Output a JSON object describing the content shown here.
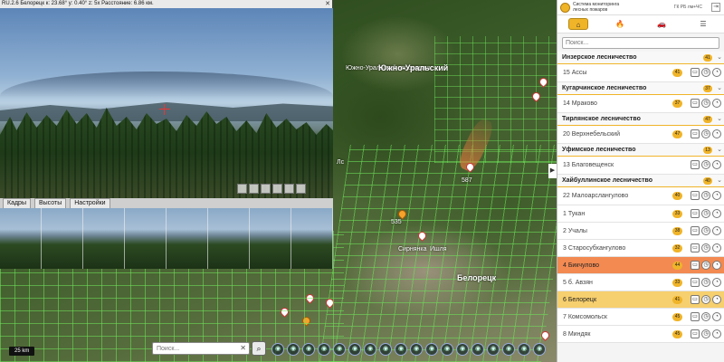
{
  "camera": {
    "title": "RU.2.6 Белорецк к: 23.68° у: 0.40° z: 5x Расстояние: 6.86 км.",
    "tabs": [
      "Кадры",
      "Высоты",
      "Настройки"
    ]
  },
  "map": {
    "labels": {
      "zone1": "Южно-Уральский заповедник",
      "zone2": "Южно-Уральский",
      "area": "Ишля",
      "city": "Белорецк",
      "town": "Сирнянка",
      "road": "Лс"
    },
    "pin_labels": [
      "535",
      "587"
    ],
    "scale": "25 km",
    "search_placeholder": "Поиск...",
    "tools": [
      "◉",
      "◉",
      "◉",
      "◉",
      "◉",
      "◉",
      "◉",
      "◉",
      "◉",
      "◉",
      "◉",
      "◉",
      "◉",
      "◉",
      "◉",
      "◉",
      "◉",
      "◉"
    ]
  },
  "panel": {
    "system_title": "Система мониторинга лесных пожаров",
    "user": "ГК РБ лм+ЧС",
    "nav": [
      "⌂",
      "🔥",
      "🚗",
      "☰"
    ],
    "search_placeholder": "Поиск...",
    "groups": [
      {
        "name": "Инзерское лесничество",
        "count": "41",
        "stations": [
          {
            "name": "15 Ассы",
            "badge": "41",
            "state": ""
          }
        ]
      },
      {
        "name": "Кугарчинское лесничество",
        "count": "37",
        "stations": [
          {
            "name": "14 Мраково",
            "badge": "37",
            "state": ""
          }
        ]
      },
      {
        "name": "Тирлянское лесничество",
        "count": "47",
        "stations": [
          {
            "name": "20 Верхнебельский",
            "badge": "47",
            "state": ""
          }
        ]
      },
      {
        "name": "Уфимское лесничество",
        "count": "13",
        "stations": [
          {
            "name": "13 Благовещенск",
            "badge": "",
            "state": ""
          }
        ]
      },
      {
        "name": "Хайбуллинское лесничество",
        "count": "40",
        "stations": [
          {
            "name": "22 Малоарслангулово",
            "badge": "40",
            "state": ""
          },
          {
            "name": "1 Тукан",
            "badge": "33",
            "state": ""
          },
          {
            "name": "2 Учалы",
            "badge": "38",
            "state": ""
          },
          {
            "name": "3 Старосубхангулово",
            "badge": "32",
            "state": ""
          },
          {
            "name": "4 Бикчулово",
            "badge": "44",
            "state": "hl-orange"
          },
          {
            "name": "5 б. Авзян",
            "badge": "33",
            "state": ""
          },
          {
            "name": "6 Белорецк",
            "badge": "41",
            "state": "hl-yellow"
          },
          {
            "name": "7 Комсомольск",
            "badge": "45",
            "state": ""
          },
          {
            "name": "8 Миндяк",
            "badge": "45",
            "state": ""
          }
        ]
      }
    ],
    "actions": [
      "▭",
      "◷",
      "◔"
    ]
  },
  "colors": {
    "accent": "#f0b429",
    "highlight_orange": "#f28a52",
    "highlight_yellow": "#f6cf6e",
    "grid": "#6ee65a"
  },
  "icons": [
    "search-icon",
    "flame-icon",
    "car-icon",
    "menu-icon",
    "home-icon",
    "camera-icon",
    "history-icon",
    "rotate-icon",
    "close-icon",
    "chevron-down-icon",
    "chevron-right-icon",
    "exit-icon",
    "fire-pin-icon"
  ]
}
